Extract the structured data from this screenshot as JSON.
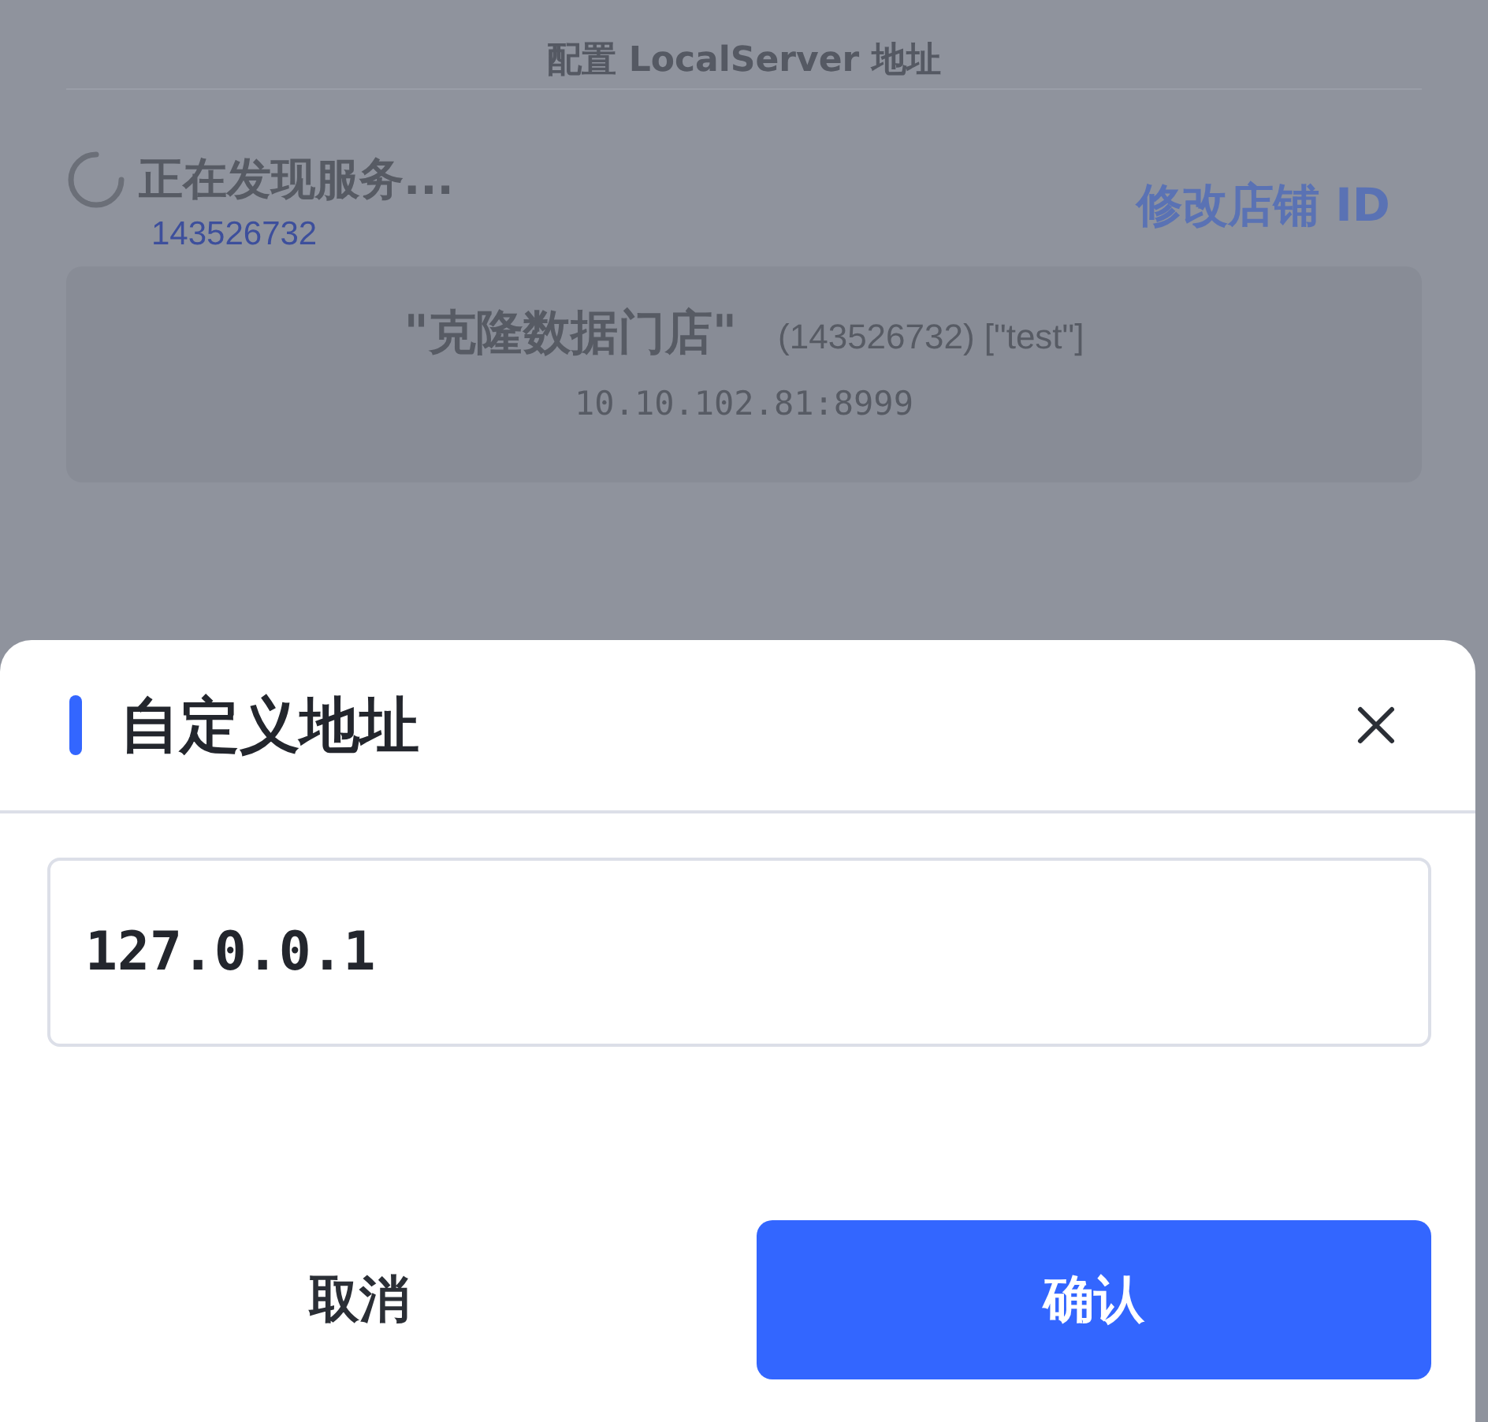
{
  "page": {
    "title": "配置 LocalServer 地址",
    "status": {
      "text": "正在发现服务...",
      "loading": true
    },
    "store_id": "143526732",
    "change_store_link": "修改店铺 ID",
    "server_card": {
      "name": "\"克隆数据门店\"",
      "details": "(143526732) [\"test\"]",
      "address": "10.10.102.81:8999"
    }
  },
  "dialog": {
    "title": "自定义地址",
    "input": {
      "value": "127.0.0.1"
    },
    "buttons": [
      {
        "label": "取消",
        "kind": "secondary"
      },
      {
        "label": "确认",
        "kind": "primary"
      }
    ]
  }
}
